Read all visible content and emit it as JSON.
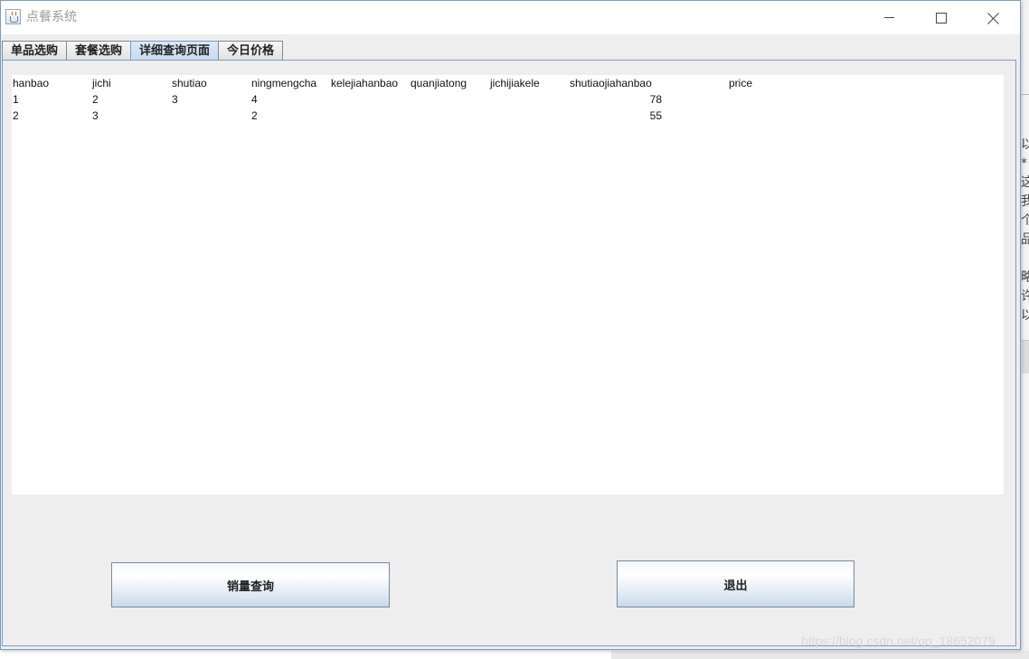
{
  "window": {
    "title": "点餐系统"
  },
  "tabs": [
    {
      "label": "单品选购",
      "active": false
    },
    {
      "label": "套餐选购",
      "active": false
    },
    {
      "label": "详细查询页面",
      "active": true
    },
    {
      "label": "今日价格",
      "active": false
    }
  ],
  "results": {
    "headers": [
      "hanbao",
      "jichi",
      "shutiao",
      "ningmengcha",
      "kelejiahanbao",
      "quanjiatong",
      "jichijiakele",
      "shutiaojiahanbao",
      "price"
    ],
    "rows": [
      {
        "hanbao": "1",
        "jichi": "2",
        "shutiao": "3",
        "ningmengcha": "4",
        "price": "78"
      },
      {
        "hanbao": "2",
        "jichi": "3",
        "shutiao": "",
        "ningmengcha": "2",
        "price": "55"
      }
    ]
  },
  "buttons": {
    "sales_query": "销量查询",
    "exit": "退出"
  },
  "background_window": {
    "glyphs": "以\n*\n这\n我\n个\n品\n\n略\n许\n以"
  },
  "watermark": "https://blog.csdn.net/qq_18652079",
  "colors": {
    "active_tab": "#c8daf0",
    "window_border": "#7a9cc6",
    "panel_bg": "#eeeeee"
  }
}
